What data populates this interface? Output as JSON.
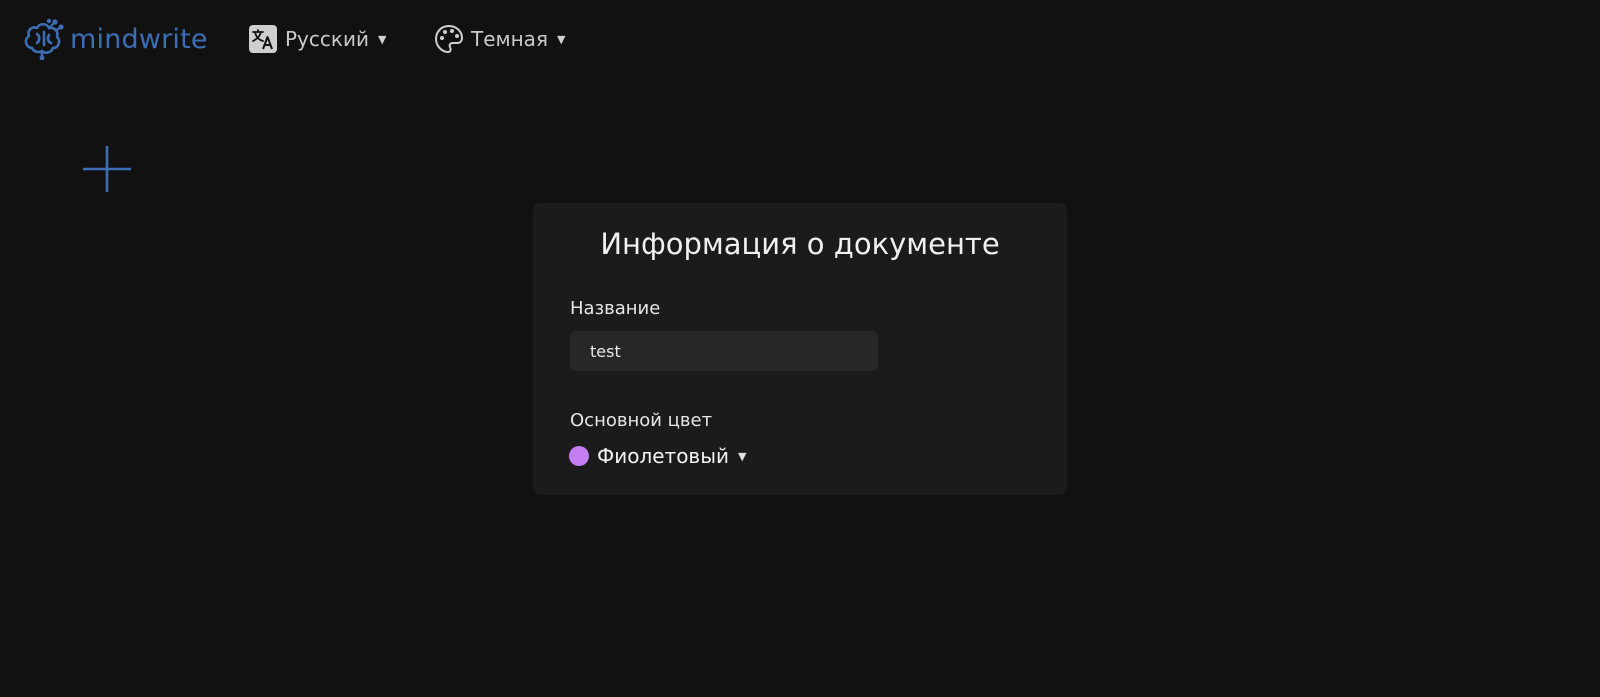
{
  "header": {
    "brand": "mindwrite",
    "brand_color": "#3d6db5",
    "language": {
      "label": "Русский",
      "icon": "translate-icon"
    },
    "theme": {
      "label": "Темная",
      "icon": "palette-icon"
    }
  },
  "toolbar": {
    "add_icon": "plus-icon"
  },
  "document_info": {
    "title": "Информация о документе",
    "name_label": "Название",
    "name_value": "test",
    "color_label": "Основной цвет",
    "color_value": "Фиолетовый",
    "color_hex": "#c47df2"
  }
}
